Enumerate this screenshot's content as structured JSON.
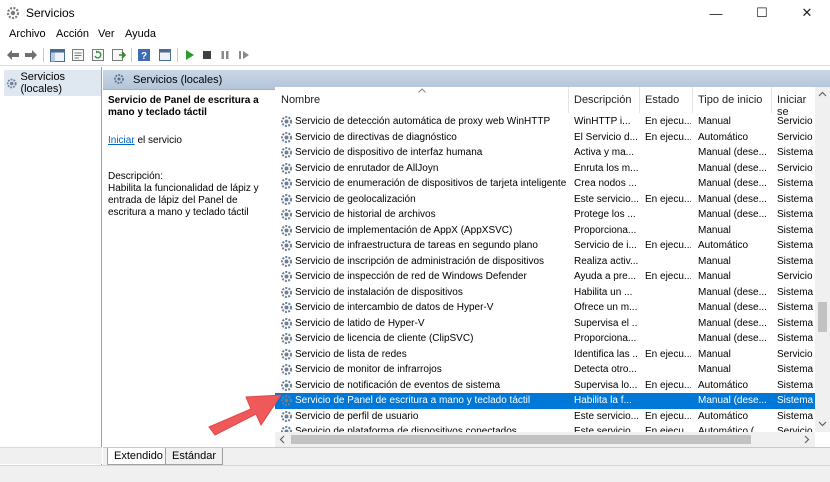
{
  "window": {
    "title": "Servicios"
  },
  "window_controls": {
    "minimize": "—",
    "maximize": "☐",
    "close": "✕"
  },
  "menu": [
    "Archivo",
    "Acción",
    "Ver",
    "Ayuda"
  ],
  "tree": {
    "root": "Servicios (locales)"
  },
  "pane_header": "Servicios (locales)",
  "detail": {
    "service_title": "Servicio de Panel de escritura a mano y teclado táctil",
    "action_link": "Iniciar",
    "action_rest": " el servicio",
    "description_label": "Descripción:",
    "description_text": "Habilita la funcionalidad de lápiz y entrada de lápiz del Panel de escritura a mano y teclado táctil"
  },
  "table": {
    "columns": [
      "Nombre",
      "Descripción",
      "Estado",
      "Tipo de inicio",
      "Iniciar se"
    ],
    "rows": [
      [
        "Servicio de detección automática de proxy web WinHTTP",
        "WinHTTP i...",
        "En ejecu...",
        "Manual",
        "Servicio"
      ],
      [
        "Servicio de directivas de diagnóstico",
        "El Servicio d...",
        "En ejecu...",
        "Automático",
        "Servicio"
      ],
      [
        "Servicio de dispositivo de interfaz humana",
        "Activa y ma...",
        "",
        "Manual (dese...",
        "Sistema"
      ],
      [
        "Servicio de enrutador de AllJoyn",
        "Enruta los m...",
        "",
        "Manual (dese...",
        "Servicio"
      ],
      [
        "Servicio de enumeración de dispositivos de tarjeta inteligente",
        "Crea nodos ...",
        "",
        "Manual (dese...",
        "Sistema"
      ],
      [
        "Servicio de geolocalización",
        "Este servicio...",
        "En ejecu...",
        "Manual (dese...",
        "Sistema"
      ],
      [
        "Servicio de historial de archivos",
        "Protege los ...",
        "",
        "Manual (dese...",
        "Sistema"
      ],
      [
        "Servicio de implementación de AppX (AppXSVC)",
        "Proporciona...",
        "",
        "Manual",
        "Sistema"
      ],
      [
        "Servicio de infraestructura de tareas en segundo plano",
        "Servicio de i...",
        "En ejecu...",
        "Automático",
        "Sistema"
      ],
      [
        "Servicio de inscripción de administración de dispositivos",
        "Realiza activ...",
        "",
        "Manual",
        "Sistema"
      ],
      [
        "Servicio de inspección de red de Windows Defender",
        "Ayuda a pre...",
        "En ejecu...",
        "Manual",
        "Servicio"
      ],
      [
        "Servicio de instalación de dispositivos",
        "Habilita un ...",
        "",
        "Manual (dese...",
        "Sistema"
      ],
      [
        "Servicio de intercambio de datos de Hyper-V",
        "Ofrece un m...",
        "",
        "Manual (dese...",
        "Sistema"
      ],
      [
        "Servicio de latido de Hyper-V",
        "Supervisa el ...",
        "",
        "Manual (dese...",
        "Sistema"
      ],
      [
        "Servicio de licencia de cliente (ClipSVC)",
        "Proporciona...",
        "",
        "Manual (dese...",
        "Sistema"
      ],
      [
        "Servicio de lista de redes",
        "Identifica las ...",
        "En ejecu...",
        "Manual",
        "Servicio"
      ],
      [
        "Servicio de monitor de infrarrojos",
        "Detecta otro...",
        "",
        "Manual",
        "Sistema"
      ],
      [
        "Servicio de notificación de eventos de sistema",
        "Supervisa lo...",
        "En ejecu...",
        "Automático",
        "Sistema"
      ],
      [
        "Servicio de Panel de escritura a mano y teclado táctil",
        "Habilita la f...",
        "",
        "Manual (dese...",
        "Sistema"
      ],
      [
        "Servicio de perfil de usuario",
        "Este servicio...",
        "En ejecu...",
        "Automático",
        "Sistema"
      ],
      [
        "Servicio de plataforma de dispositivos conectados",
        "Este servicio...",
        "En ejecu...",
        "Automático (...",
        "Servicio"
      ]
    ],
    "selected_index": 18
  },
  "tabs": [
    "Extendido",
    "Estándar"
  ],
  "colors": {
    "selection": "#0078d7",
    "header": "#b9cbe0",
    "arrow": "#f0595a",
    "link": "#0066cc"
  }
}
